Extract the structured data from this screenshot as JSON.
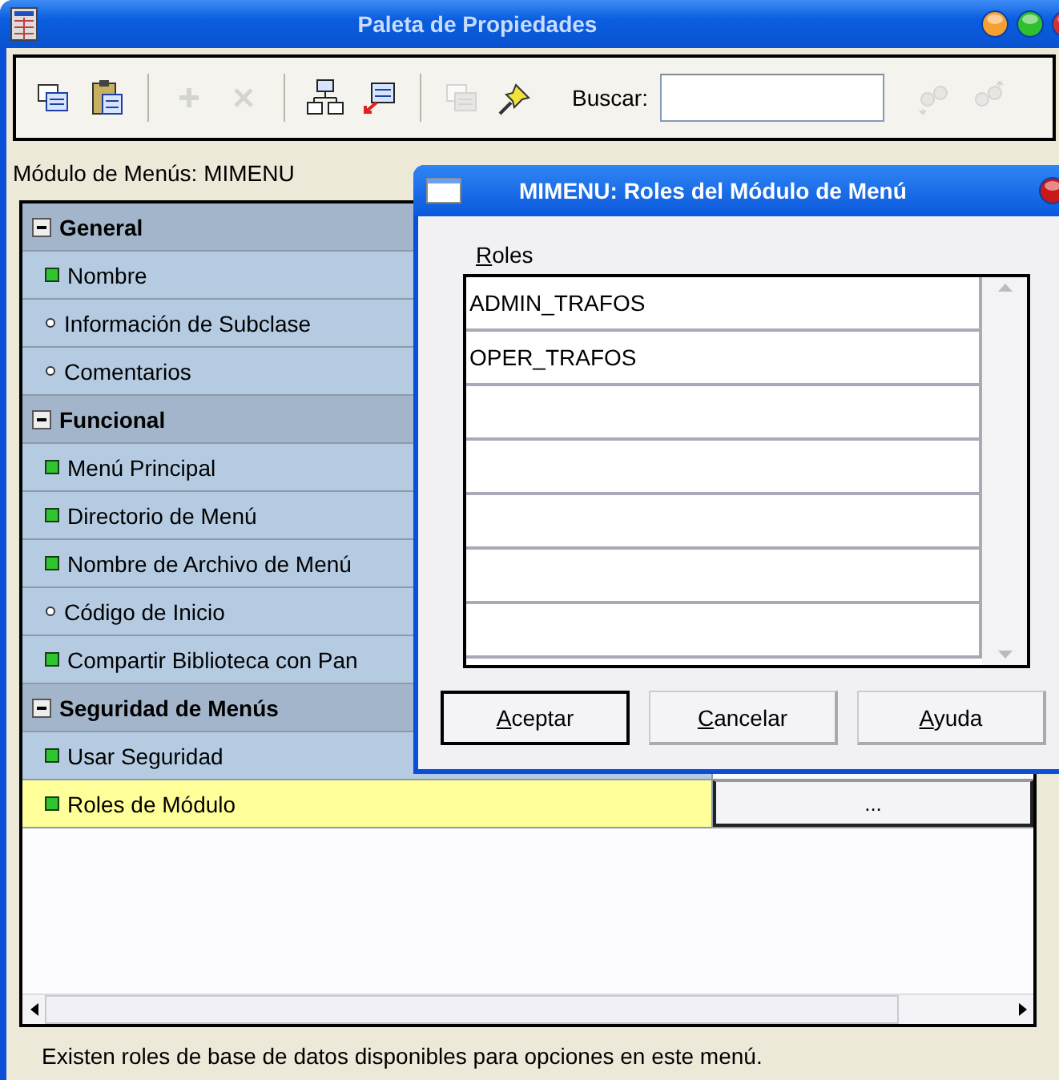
{
  "window": {
    "title": "Paleta de Propiedades"
  },
  "toolbar": {
    "groups": [
      [
        {
          "kind": "copy",
          "disabled": false
        },
        {
          "kind": "paste",
          "disabled": false
        }
      ],
      [
        {
          "kind": "add",
          "disabled": true
        },
        {
          "kind": "delete",
          "disabled": true
        }
      ],
      [
        {
          "kind": "tree",
          "disabled": false
        },
        {
          "kind": "inherit",
          "disabled": false
        }
      ],
      [
        {
          "kind": "copy",
          "disabled": true
        },
        {
          "kind": "pin",
          "disabled": false
        }
      ]
    ],
    "search": {
      "label": "Buscar:"
    },
    "search_buttons": [
      {
        "kind": "next",
        "disabled": true
      },
      {
        "kind": "prev",
        "disabled": true
      }
    ]
  },
  "object_label": "Módulo de Menús: MIMENU",
  "properties": [
    {
      "kind": "group",
      "name": "General",
      "expanded": true
    },
    {
      "kind": "property",
      "name": "Nombre",
      "modified": true,
      "selected": false
    },
    {
      "kind": "property",
      "name": "Información de Subclase",
      "modified": false,
      "selected": false
    },
    {
      "kind": "property",
      "name": "Comentarios",
      "modified": false,
      "selected": false
    },
    {
      "kind": "group",
      "name": "Funcional",
      "expanded": true
    },
    {
      "kind": "property",
      "name": "Menú Principal",
      "modified": true,
      "selected": false
    },
    {
      "kind": "property",
      "name": "Directorio de Menú",
      "modified": true,
      "selected": false
    },
    {
      "kind": "property",
      "name": "Nombre de Archivo de Menú",
      "modified": true,
      "selected": false
    },
    {
      "kind": "property",
      "name": "Código de Inicio",
      "modified": false,
      "selected": false
    },
    {
      "kind": "property",
      "name": "Compartir Biblioteca con Pan",
      "modified": true,
      "selected": false
    },
    {
      "kind": "group",
      "name": "Seguridad de Menús",
      "expanded": true
    },
    {
      "kind": "property",
      "name": "Usar Seguridad",
      "modified": true,
      "selected": false
    },
    {
      "kind": "property",
      "name": "Roles de Módulo",
      "modified": true,
      "selected": true,
      "value_button": "..."
    }
  ],
  "status_bar": "Existen roles de base de datos disponibles para opciones en este menú.",
  "dialog": {
    "title": "MIMENU: Roles del Módulo de Menú",
    "list_label": "Roles",
    "roles": [
      "ADMIN_TRAFOS",
      "OPER_TRAFOS"
    ],
    "buttons": [
      {
        "label": "Aceptar",
        "default": true
      },
      {
        "label": "Cancelar",
        "default": false
      },
      {
        "label": "Ayuda",
        "default": false
      }
    ]
  }
}
